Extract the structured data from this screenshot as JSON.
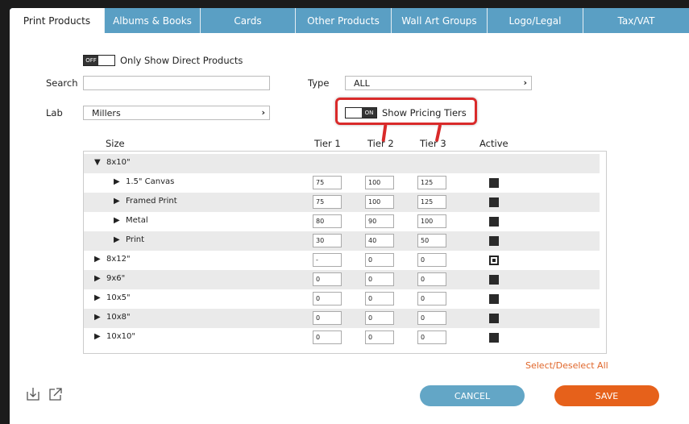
{
  "tabs": [
    {
      "label": "Print Products",
      "active": true
    },
    {
      "label": "Albums & Books"
    },
    {
      "label": "Cards"
    },
    {
      "label": "Other Products"
    },
    {
      "label": "Wall Art Groups"
    },
    {
      "label": "Logo/Legal"
    },
    {
      "label": "Tax/VAT"
    }
  ],
  "filters": {
    "direct_toggle_state": "OFF",
    "direct_toggle_label": "Only Show Direct Products",
    "search_label": "Search",
    "search_value": "",
    "type_label": "Type",
    "type_value": "ALL",
    "lab_label": "Lab",
    "lab_value": "Millers",
    "pricing_toggle_state": "ON",
    "pricing_toggle_label": "Show Pricing Tiers"
  },
  "columns": {
    "size": "Size",
    "tier1": "Tier 1",
    "tier2": "Tier 2",
    "tier3": "Tier 3",
    "active": "Active"
  },
  "rows": [
    {
      "name": "8x10\"",
      "expanded": true,
      "level": 0,
      "tier1": null,
      "tier2": null,
      "tier3": null,
      "active": null
    },
    {
      "name": "1.5\" Canvas",
      "level": 1,
      "tier1": "75",
      "tier2": "100",
      "tier3": "125",
      "active": "filled"
    },
    {
      "name": "Framed Print",
      "level": 1,
      "tier1": "75",
      "tier2": "100",
      "tier3": "125",
      "active": "filled"
    },
    {
      "name": "Metal",
      "level": 1,
      "tier1": "80",
      "tier2": "90",
      "tier3": "100",
      "active": "filled"
    },
    {
      "name": "Print",
      "level": 1,
      "tier1": "30",
      "tier2": "40",
      "tier3": "50",
      "active": "filled"
    },
    {
      "name": "8x12\"",
      "level": 0,
      "tier1": "-",
      "tier2": "0",
      "tier3": "0",
      "active": "selected"
    },
    {
      "name": "9x6\"",
      "level": 0,
      "tier1": "0",
      "tier2": "0",
      "tier3": "0",
      "active": "filled"
    },
    {
      "name": "10x5\"",
      "level": 0,
      "tier1": "0",
      "tier2": "0",
      "tier3": "0",
      "active": "filled"
    },
    {
      "name": "10x8\"",
      "level": 0,
      "tier1": "0",
      "tier2": "0",
      "tier3": "0",
      "active": "filled"
    },
    {
      "name": "10x10\"",
      "level": 0,
      "tier1": "0",
      "tier2": "0",
      "tier3": "0",
      "active": "filled"
    }
  ],
  "select_deselect_label": "Select/Deselect All",
  "buttons": {
    "cancel": "CANCEL",
    "save": "SAVE"
  },
  "icons": [
    "import-icon",
    "export-icon"
  ],
  "colors": {
    "tab_bg": "#5a9fc4",
    "cancel": "#63a6c6",
    "save": "#e6611b",
    "link": "#e0662a",
    "highlight": "#d92a2a"
  }
}
